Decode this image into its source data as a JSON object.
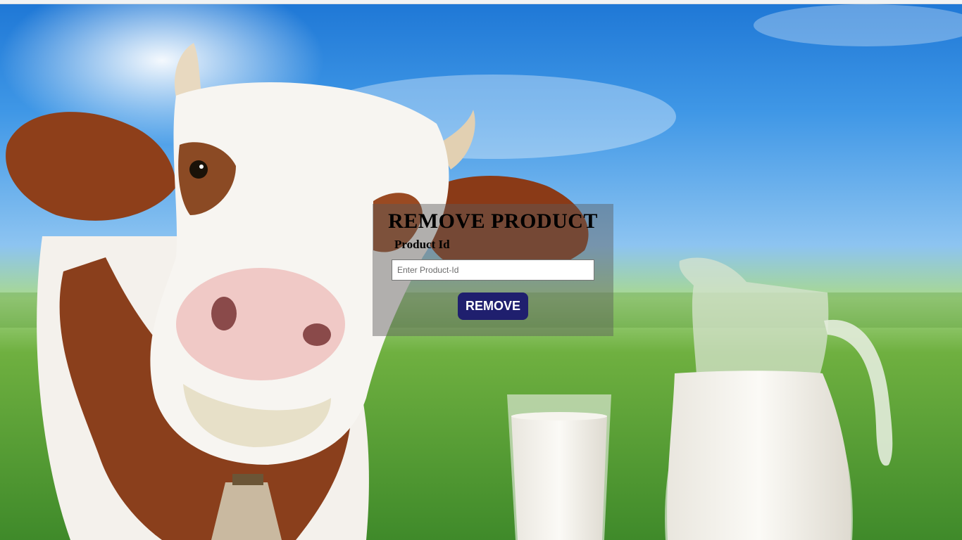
{
  "background": {
    "description_icon": "cow-and-milk-background-image",
    "colors": {
      "sky": "#3f97e6",
      "grass": "#6fb040"
    }
  },
  "form": {
    "title": "REMOVE PRODUCT",
    "product_id_label": "Product Id",
    "product_id_value": "",
    "product_id_placeholder": "Enter Product-Id",
    "remove_label": "REMOVE",
    "button_color": "#1f1f6e"
  }
}
